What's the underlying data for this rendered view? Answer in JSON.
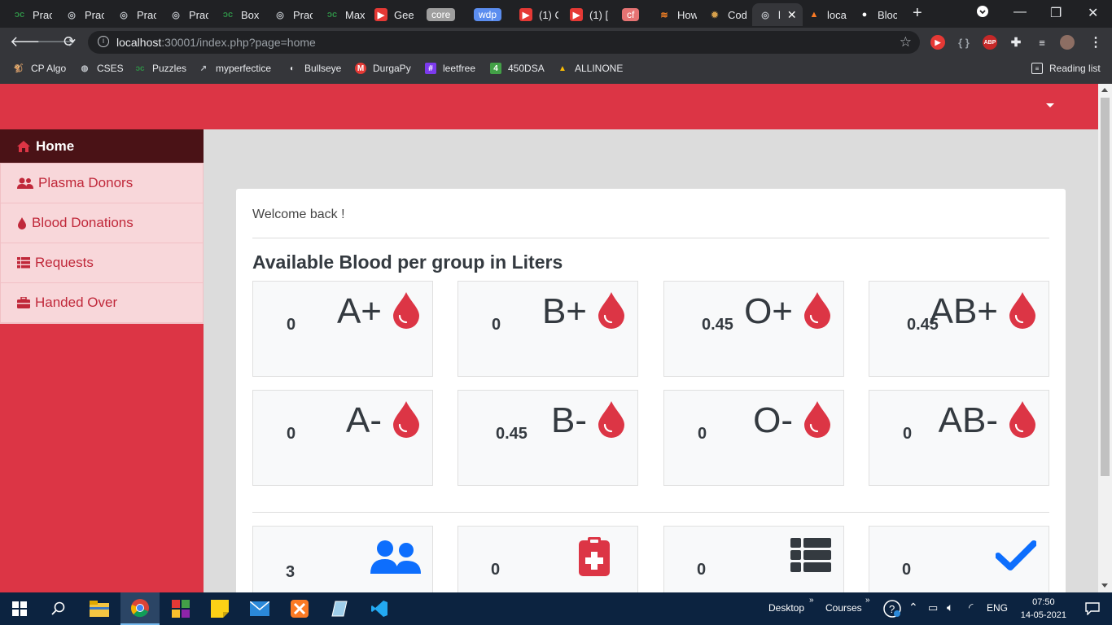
{
  "browser": {
    "tabs": [
      {
        "label": "Prac",
        "icon": "gfg-icon"
      },
      {
        "label": "Prac",
        "icon": "globe-icon"
      },
      {
        "label": "Prac",
        "icon": "globe-icon"
      },
      {
        "label": "Prac",
        "icon": "globe-icon"
      },
      {
        "label": "Box",
        "icon": "gfg-icon"
      },
      {
        "label": "Prac",
        "icon": "globe-icon"
      },
      {
        "label": "Max",
        "icon": "gfg-icon"
      },
      {
        "label": "Gee",
        "icon": "youtube-icon"
      },
      {
        "label": "core",
        "icon": "pill-gray"
      },
      {
        "label": "wdp",
        "icon": "pill-blue"
      },
      {
        "label": "(1) C",
        "icon": "youtube-icon"
      },
      {
        "label": "(1) [",
        "icon": "youtube-icon"
      },
      {
        "label": "cf",
        "icon": "pill-red"
      },
      {
        "label": "How",
        "icon": "stackoverflow-icon"
      },
      {
        "label": "Cod",
        "icon": "codechef-icon"
      },
      {
        "label": "l",
        "icon": "globe-icon"
      },
      {
        "label": "loca",
        "icon": "xampp-icon"
      },
      {
        "label": "Bloc",
        "icon": "github-icon"
      }
    ],
    "new_tab": "+",
    "url_host": "localhost",
    "url_rest": ":30001/index.php?page=home",
    "bookmarks": [
      {
        "label": "CP Algo",
        "color": "#d9a441"
      },
      {
        "label": "CSES",
        "color": "#bdc1c6"
      },
      {
        "label": "Puzzles",
        "color": "#2f8d46"
      },
      {
        "label": "myperfectice",
        "color": "#bdc1c6"
      },
      {
        "label": "Bullseye",
        "color": "#e8eaed"
      },
      {
        "label": "DurgaPy",
        "color": "#e53935"
      },
      {
        "label": "leetfree",
        "color": "#7c3aed"
      },
      {
        "label": "450DSA",
        "color": "#43a047"
      },
      {
        "label": "ALLINONE",
        "color": "#fbbc04"
      }
    ],
    "reading_list": "Reading list"
  },
  "page": {
    "sidebar": [
      {
        "label": "Home",
        "icon": "home-icon",
        "active": true
      },
      {
        "label": "Plasma Donors",
        "icon": "users-icon"
      },
      {
        "label": "Blood Donations",
        "icon": "tint-icon"
      },
      {
        "label": "Requests",
        "icon": "list-icon"
      },
      {
        "label": "Handed Over",
        "icon": "toolbox-icon"
      }
    ],
    "welcome": "Welcome back !",
    "heading": "Available Blood per group in Liters",
    "groups": [
      {
        "group": "A+",
        "value": "0"
      },
      {
        "group": "B+",
        "value": "0"
      },
      {
        "group": "O+",
        "value": "0.45"
      },
      {
        "group": "AB+",
        "value": "0.45"
      },
      {
        "group": "A-",
        "value": "0"
      },
      {
        "group": "B-",
        "value": "0.45"
      },
      {
        "group": "O-",
        "value": "0"
      },
      {
        "group": "AB-",
        "value": "0"
      }
    ],
    "stats": [
      {
        "value": "3",
        "icon": "users-icon"
      },
      {
        "value": "0",
        "icon": "medical-clipboard-icon"
      },
      {
        "value": "0",
        "icon": "list-icon"
      },
      {
        "value": "0",
        "icon": "check-icon"
      }
    ],
    "colors": {
      "primary": "#dc3545",
      "accent_blue": "#0d6efd"
    }
  },
  "taskbar": {
    "desktop": "Desktop",
    "courses": "Courses",
    "lang": "ENG",
    "time": "07:50",
    "date": "14-05-2021"
  }
}
